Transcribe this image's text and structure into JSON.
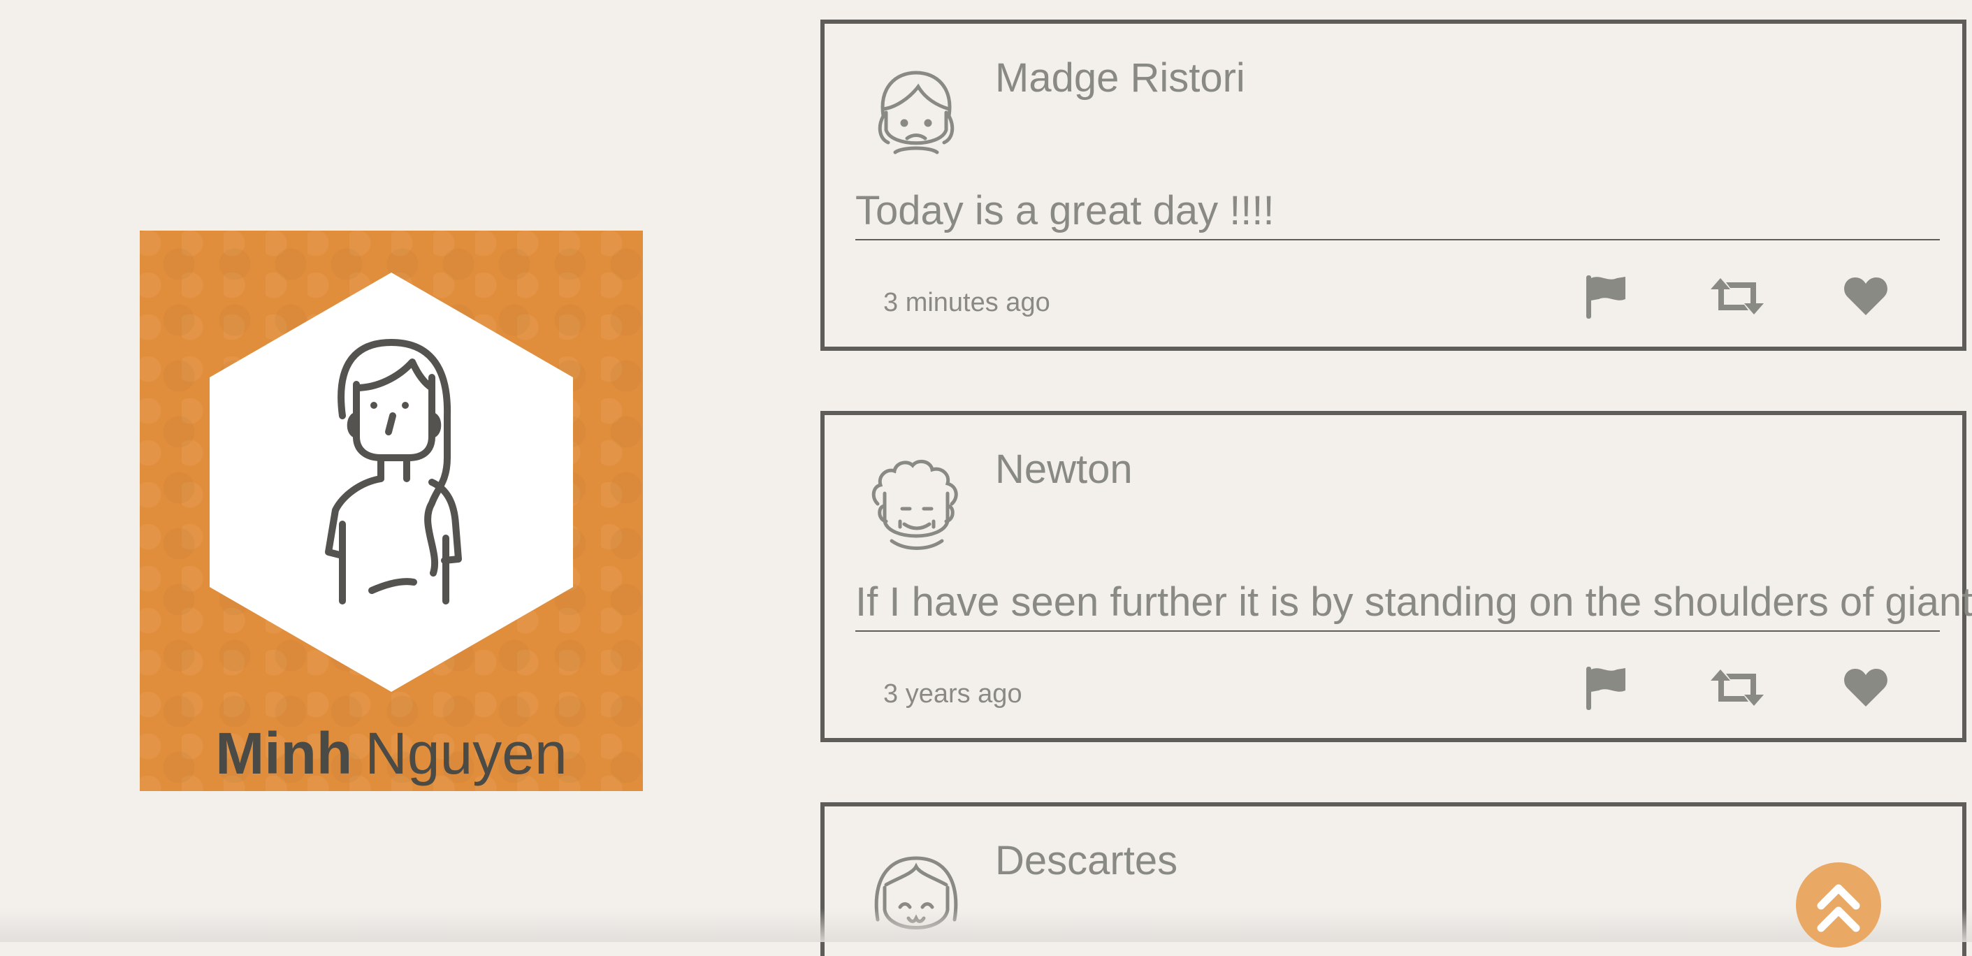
{
  "profile": {
    "first_name": "Minh",
    "last_name": "Nguyen",
    "card_color": "#e18e3c",
    "avatar_icon": "woman-avatar-icon"
  },
  "posts": [
    {
      "author": "Madge Ristori",
      "avatar_icon": "girl-avatar-icon",
      "message": "Today is a great day !!!!",
      "time": "3 minutes ago"
    },
    {
      "author": "Newton",
      "avatar_icon": "curly-hair-avatar-icon",
      "message": "If I have seen further it is by standing on the shoulders of giants",
      "time": "3 years ago"
    },
    {
      "author": "Descartes",
      "avatar_icon": "bob-hair-avatar-icon",
      "message": "",
      "time": ""
    }
  ],
  "actions": {
    "flag_icon": "flag-icon",
    "retweet_icon": "retweet-icon",
    "like_icon": "heart-icon"
  },
  "scroll_top_icon": "double-chevron-up-icon",
  "colors": {
    "background": "#f3f0ec",
    "border": "#5f5d59",
    "text": "#8a8a85",
    "scroll_button": "#eaa865"
  }
}
